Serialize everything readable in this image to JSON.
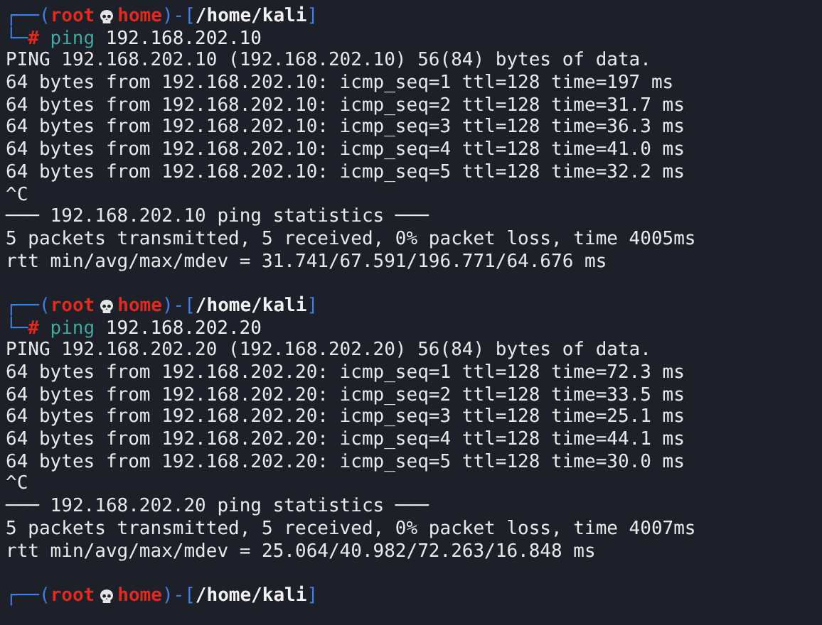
{
  "terminal": {
    "lines": [
      {
        "kind": "prompt",
        "segments": [
          {
            "kind": "frame",
            "text": "┌──("
          },
          {
            "kind": "user",
            "text": "root"
          },
          {
            "kind": "skull"
          },
          {
            "kind": "host",
            "text": "home"
          },
          {
            "kind": "frame",
            "text": ")-["
          },
          {
            "kind": "path",
            "text": "/home/kali"
          },
          {
            "kind": "frame",
            "text": "]"
          }
        ]
      },
      {
        "kind": "prompt",
        "segments": [
          {
            "kind": "frame",
            "text": "└─"
          },
          {
            "kind": "symbol",
            "text": "#"
          },
          {
            "kind": "command",
            "text": "ping"
          },
          {
            "kind": "arg",
            "text": "192.168.202.10"
          }
        ]
      },
      {
        "kind": "output",
        "text": "PING 192.168.202.10 (192.168.202.10) 56(84) bytes of data."
      },
      {
        "kind": "output",
        "text": "64 bytes from 192.168.202.10: icmp_seq=1 ttl=128 time=197 ms"
      },
      {
        "kind": "output",
        "text": "64 bytes from 192.168.202.10: icmp_seq=2 ttl=128 time=31.7 ms"
      },
      {
        "kind": "output",
        "text": "64 bytes from 192.168.202.10: icmp_seq=3 ttl=128 time=36.3 ms"
      },
      {
        "kind": "output",
        "text": "64 bytes from 192.168.202.10: icmp_seq=4 ttl=128 time=41.0 ms"
      },
      {
        "kind": "output",
        "text": "64 bytes from 192.168.202.10: icmp_seq=5 ttl=128 time=32.2 ms"
      },
      {
        "kind": "output",
        "text": "^C"
      },
      {
        "kind": "output",
        "text": "─── 192.168.202.10 ping statistics ───"
      },
      {
        "kind": "output",
        "text": "5 packets transmitted, 5 received, 0% packet loss, time 4005ms"
      },
      {
        "kind": "output",
        "text": "rtt min/avg/max/mdev = 31.741/67.591/196.771/64.676 ms"
      },
      {
        "kind": "blank"
      },
      {
        "kind": "prompt",
        "segments": [
          {
            "kind": "frame",
            "text": "┌──("
          },
          {
            "kind": "user",
            "text": "root"
          },
          {
            "kind": "skull"
          },
          {
            "kind": "host",
            "text": "home"
          },
          {
            "kind": "frame",
            "text": ")-["
          },
          {
            "kind": "path",
            "text": "/home/kali"
          },
          {
            "kind": "frame",
            "text": "]"
          }
        ]
      },
      {
        "kind": "prompt",
        "segments": [
          {
            "kind": "frame",
            "text": "└─"
          },
          {
            "kind": "symbol",
            "text": "#"
          },
          {
            "kind": "command",
            "text": "ping"
          },
          {
            "kind": "arg",
            "text": "192.168.202.20"
          }
        ]
      },
      {
        "kind": "output",
        "text": "PING 192.168.202.20 (192.168.202.20) 56(84) bytes of data."
      },
      {
        "kind": "output",
        "text": "64 bytes from 192.168.202.20: icmp_seq=1 ttl=128 time=72.3 ms"
      },
      {
        "kind": "output",
        "text": "64 bytes from 192.168.202.20: icmp_seq=2 ttl=128 time=33.5 ms"
      },
      {
        "kind": "output",
        "text": "64 bytes from 192.168.202.20: icmp_seq=3 ttl=128 time=25.1 ms"
      },
      {
        "kind": "output",
        "text": "64 bytes from 192.168.202.20: icmp_seq=4 ttl=128 time=44.1 ms"
      },
      {
        "kind": "output",
        "text": "64 bytes from 192.168.202.20: icmp_seq=5 ttl=128 time=30.0 ms"
      },
      {
        "kind": "output",
        "text": "^C"
      },
      {
        "kind": "output",
        "text": "─── 192.168.202.20 ping statistics ───"
      },
      {
        "kind": "output",
        "text": "5 packets transmitted, 5 received, 0% packet loss, time 4007ms"
      },
      {
        "kind": "output",
        "text": "rtt min/avg/max/mdev = 25.064/40.982/72.263/16.848 ms"
      },
      {
        "kind": "blank"
      },
      {
        "kind": "prompt",
        "segments": [
          {
            "kind": "frame",
            "text": "┌──("
          },
          {
            "kind": "user",
            "text": "root"
          },
          {
            "kind": "skull"
          },
          {
            "kind": "host",
            "text": "home"
          },
          {
            "kind": "frame",
            "text": ")-["
          },
          {
            "kind": "path",
            "text": "/home/kali"
          },
          {
            "kind": "frame",
            "text": "]"
          }
        ]
      }
    ]
  }
}
